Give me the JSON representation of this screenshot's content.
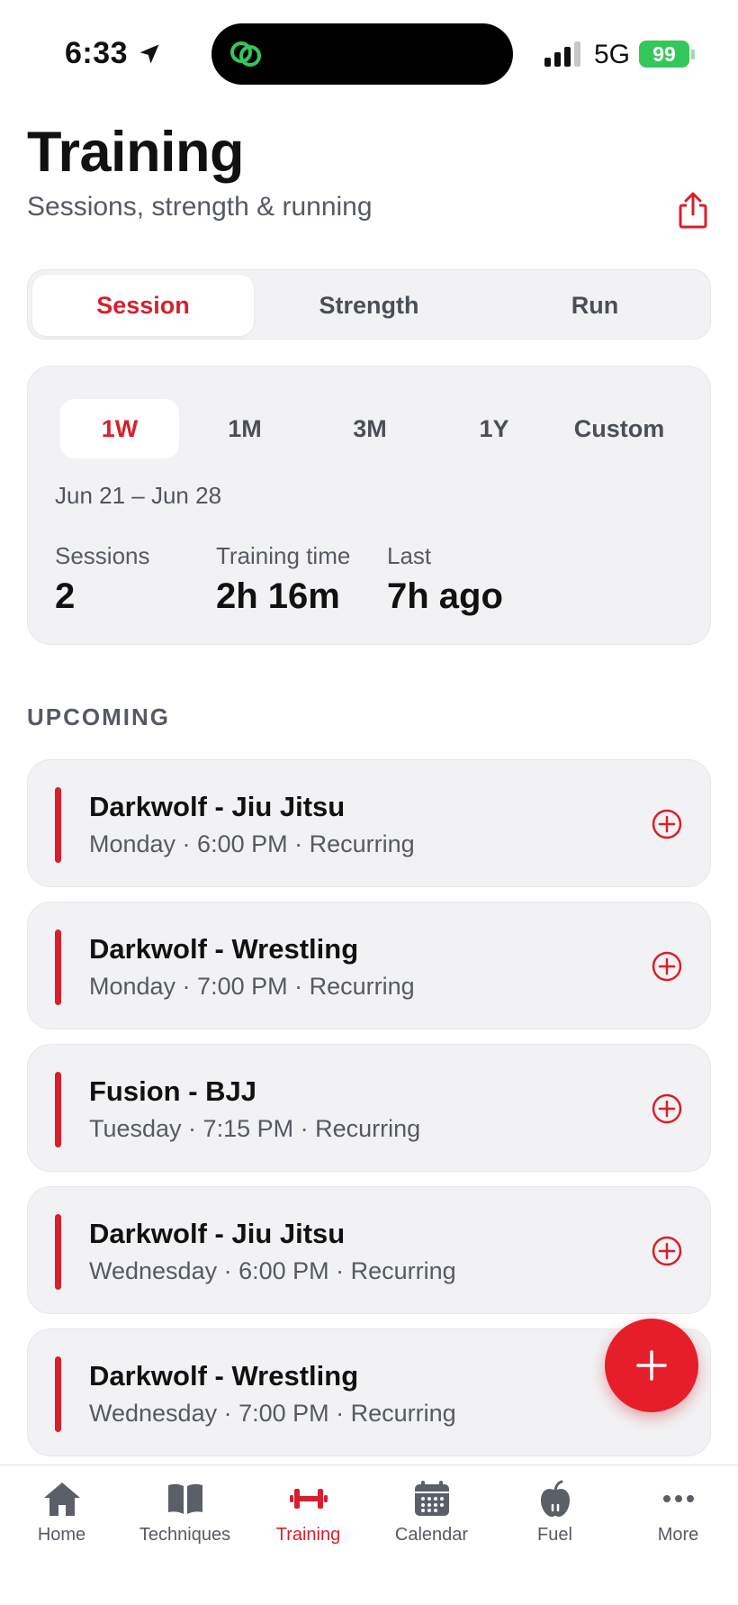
{
  "status": {
    "time": "6:33",
    "network": "5G",
    "battery": "99"
  },
  "header": {
    "title": "Training",
    "subtitle": "Sessions, strength & running"
  },
  "segments": [
    {
      "label": "Session",
      "active": true
    },
    {
      "label": "Strength",
      "active": false
    },
    {
      "label": "Run",
      "active": false
    }
  ],
  "summary": {
    "ranges": [
      {
        "label": "1W",
        "active": true
      },
      {
        "label": "1M",
        "active": false
      },
      {
        "label": "3M",
        "active": false
      },
      {
        "label": "1Y",
        "active": false
      },
      {
        "label": "Custom",
        "active": false
      }
    ],
    "date_range": "Jun 21 – Jun 28",
    "stats": [
      {
        "label": "Sessions",
        "value": "2"
      },
      {
        "label": "Training time",
        "value": "2h 16m"
      },
      {
        "label": "Last",
        "value": "7h ago"
      }
    ]
  },
  "upcoming": {
    "title": "UPCOMING",
    "events": [
      {
        "title": "Darkwolf - Jiu Jitsu",
        "subtitle": "Monday · 6:00 PM · Recurring"
      },
      {
        "title": "Darkwolf - Wrestling",
        "subtitle": "Monday · 7:00 PM · Recurring"
      },
      {
        "title": "Fusion - BJJ",
        "subtitle": "Tuesday · 7:15 PM · Recurring"
      },
      {
        "title": "Darkwolf - Jiu Jitsu",
        "subtitle": "Wednesday · 6:00 PM · Recurring"
      },
      {
        "title": "Darkwolf - Wrestling",
        "subtitle": "Wednesday · 7:00 PM · Recurring"
      }
    ]
  },
  "tabbar": [
    {
      "label": "Home",
      "icon": "house-icon",
      "active": false
    },
    {
      "label": "Techniques",
      "icon": "book-icon",
      "active": false
    },
    {
      "label": "Training",
      "icon": "dumbbell-icon",
      "active": true
    },
    {
      "label": "Calendar",
      "icon": "calendar-icon",
      "active": false
    },
    {
      "label": "Fuel",
      "icon": "apple-icon",
      "active": false
    },
    {
      "label": "More",
      "icon": "ellipsis-icon",
      "active": false
    }
  ],
  "colors": {
    "accent": "#d81f2c",
    "card": "#f2f2f4",
    "battery": "#34c759"
  }
}
